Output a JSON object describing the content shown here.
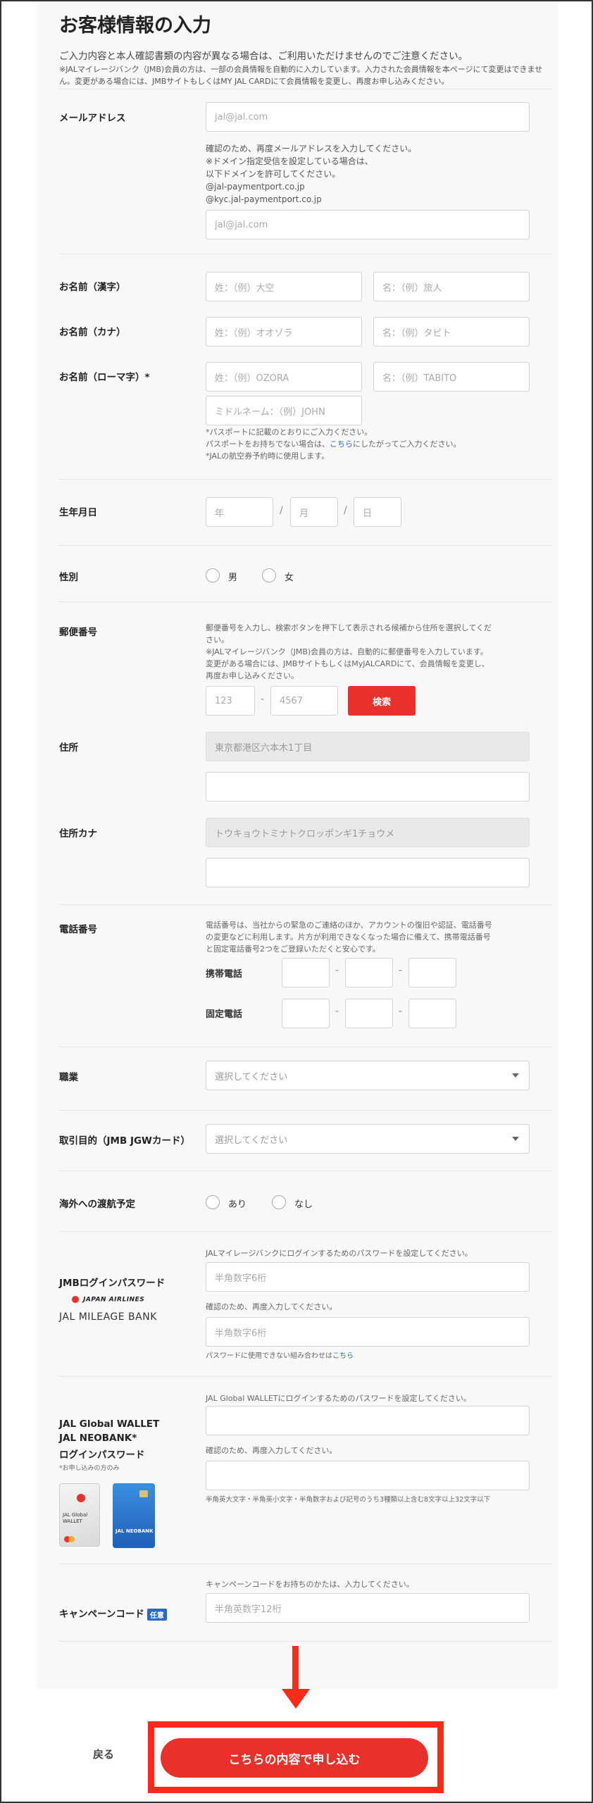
{
  "header": {
    "title": "お客様情報の入力",
    "lead": "ご入力内容と本人確認書類の内容が異なる場合は、ご利用いただけませんのでご注意ください。",
    "note1": "※JALマイレージバンク（JMB)会員の方は、一部の会員情報を自動的に入力しています。入力された会員情報を本ページにて変更はできません。変更がある場合には、JMBサイトもしくはMY JAL CARDにて会員情報を変更し、再度お申し込みください。"
  },
  "email": {
    "label": "メールアドレス",
    "placeholder": "jal@jal.com",
    "confirm_note": [
      "確認のため、再度メールアドレスを入力してください。",
      "※ドメイン指定受信を設定している場合は、",
      "以下ドメインを許可してください。",
      "@jal-paymentport.co.jp",
      "@kyc.jal-paymentport.co.jp"
    ],
    "confirm_placeholder": "jal@jal.com"
  },
  "name_kanji": {
    "label": "お名前（漢字）",
    "last": "姓：（例）大空",
    "first": "名：（例）旅人"
  },
  "name_kana": {
    "label": "お名前（カナ）",
    "last": "姓：（例）オオゾラ",
    "first": "名：（例）タビト"
  },
  "name_roman": {
    "label": "お名前（ローマ字）*",
    "last": "姓：（例）OZORA",
    "first": "名：（例）TABITO",
    "middle": "ミドルネーム：（例）JOHN",
    "note1": "*パスポートに記載のとおりにご入力ください。",
    "note2a": "パスポートをお持ちでない場合は、",
    "note2link": "こちら",
    "note2b": "にしたがってご入力ください。",
    "note3": "*JALの航空券予約時に使用します。"
  },
  "birth": {
    "label": "生年月日",
    "year": "年",
    "month": "月",
    "day": "日",
    "sep": "/"
  },
  "gender": {
    "label": "性別",
    "male": "男",
    "female": "女"
  },
  "postal": {
    "label": "郵便番号",
    "note": [
      "郵便番号を入力し、検索ボタンを押下して表示される候補から住所を選択してくだ",
      "さい。",
      "※JALマイレージバンク（JMB)会員の方は、自動的に郵便番号を入力しています。",
      "変更がある場合には、JMBサイトもしくはMyJALCARDにて、会員情報を変更し、",
      "再度お申し込みください。"
    ],
    "p1": "123",
    "dash": "-",
    "p2": "4567",
    "search_button": "検索"
  },
  "address": {
    "label": "住所",
    "placeholder": "東京都港区六本木1丁目"
  },
  "address_kana": {
    "label": "住所カナ",
    "placeholder": "トウキョウトミナトクロッポンギ1チョウメ"
  },
  "phone": {
    "label": "電話番号",
    "note": [
      "電話番号は、当社からの緊急のご連絡のほか、アカウントの復旧や認証、電話番号",
      "の変更などに利用します。片方が利用できなくなった場合に備えて、携帯電話番号",
      "と固定電話番号2つをご登録いただくと安心です。"
    ],
    "mobile_label": "携帯電話",
    "landline_label": "固定電話",
    "dash": "-"
  },
  "occupation": {
    "label": "職業",
    "placeholder": "選択してください"
  },
  "purpose": {
    "label": "取引目的（JMB JGWカード）",
    "placeholder": "選択してください"
  },
  "overseas": {
    "label": "海外への渡航予定",
    "yes": "あり",
    "no": "なし"
  },
  "jmb": {
    "label": "JMBログインパスワード",
    "logo_top": "JAPAN AIRLINES",
    "logo_bottom": "JAL MILEAGE BANK",
    "note1": "JALマイレージバンクにログインするためのパスワードを設定してください。",
    "placeholder": "半角数字6桁",
    "note2": "確認のため、再度入力してください。",
    "placeholder2": "半角数字6桁",
    "note3a": "パスワードに使用できない組み合わせは",
    "note3link": "こちら"
  },
  "wallet": {
    "label1": "JAL Global WALLET",
    "label2": "JAL NEOBANK*",
    "label3": "ログインパスワード",
    "sub": "*お申し込みの方のみ",
    "note1": "JAL Global WALLETにログインするためのパスワードを設定してください。",
    "note2": "確認のため、再度入力してください。",
    "note3": "半角英大文字・半角英小文字・半角数字および記号のうち3種類以上含む8文字以上32文字以下",
    "card1_text": "JAL Global WALLET",
    "card2_text": "JAL NEOBANK"
  },
  "campaign": {
    "label": "キャンペーンコード",
    "tag": "任意",
    "note": "キャンペーンコードをお持ちのかたは、入力してください。",
    "placeholder": "半角英数字12桁"
  },
  "footer": {
    "back": "戻る",
    "submit": "こちらの内容で申し込む"
  },
  "colors": {
    "accent": "#e8312b",
    "highlight": "#ff2a1a",
    "link": "#2a67c9"
  }
}
